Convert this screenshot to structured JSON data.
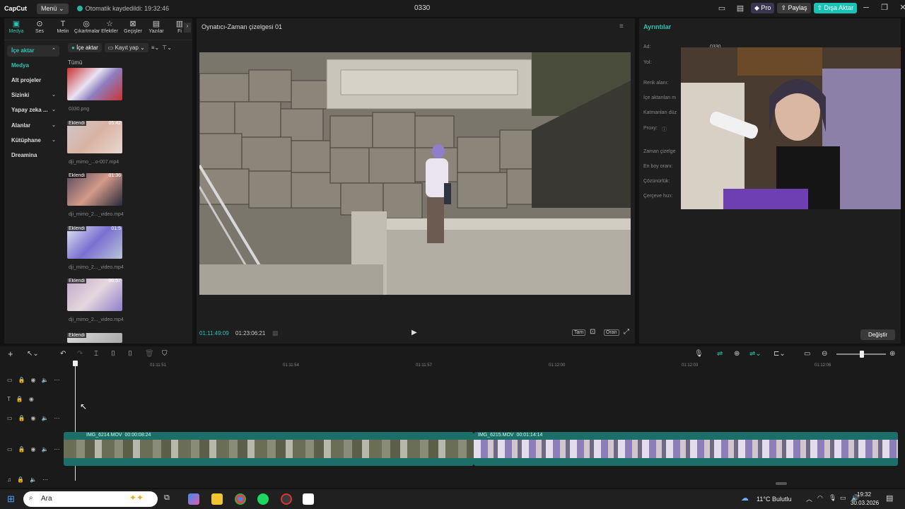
{
  "titlebar": {
    "logo": "CapCut",
    "menu": "Menü",
    "autosave": "Otomatik kaydedildi: 19:32:46",
    "title": "0330",
    "pro": "Pro",
    "share": "Paylaş",
    "export": "Dışa Aktar"
  },
  "tabs": [
    {
      "label": "Medya",
      "icon": "media-icon"
    },
    {
      "label": "Ses",
      "icon": "audio-icon"
    },
    {
      "label": "Metin",
      "icon": "text-icon"
    },
    {
      "label": "Çıkartmalar",
      "icon": "sticker-icon"
    },
    {
      "label": "Efektler",
      "icon": "effects-icon"
    },
    {
      "label": "Geçişler",
      "icon": "transitions-icon"
    },
    {
      "label": "Yazılar",
      "icon": "captions-icon"
    },
    {
      "label": "Fi",
      "icon": "filter-icon"
    }
  ],
  "sidebar": {
    "items": [
      {
        "label": "İçe aktar"
      },
      {
        "label": "Medya"
      },
      {
        "label": "Alt projeler"
      },
      {
        "label": "Sizinki"
      },
      {
        "label": "Yapay zeka ..."
      },
      {
        "label": "Alanlar"
      },
      {
        "label": "Kütüphane"
      },
      {
        "label": "Dreamina"
      }
    ]
  },
  "media_toolbar": {
    "import": "İçe aktar",
    "record": "Kayıt yap"
  },
  "media": {
    "group": "Tümü",
    "items": [
      {
        "name": "0330.png",
        "badge": "",
        "duration": ""
      },
      {
        "name": "dji_mimo_...o-007.mp4",
        "badge": "Eklendi",
        "duration": "05:42"
      },
      {
        "name": "dji_mimo_2..._video.mp4",
        "badge": "Eklendi",
        "duration": "01:36"
      },
      {
        "name": "dji_mimo_2..._video.mp4",
        "badge": "Eklendi",
        "duration": "01:5"
      },
      {
        "name": "dji_mimo_2..._video.mp4",
        "badge": "Eklendi",
        "duration": "00:57"
      },
      {
        "name": "",
        "badge": "Eklendi",
        "duration": ""
      }
    ]
  },
  "player": {
    "title": "Oynatıcı-Zaman çizelgesi 01",
    "current_time": "01:11:49:09",
    "total_time": "01:23:06:21",
    "full_label": "Tam",
    "ratio_label": "Oran"
  },
  "details": {
    "title": "Ayrıntılar",
    "labels": [
      "Ad:",
      "Yol:",
      "Renk alanı:",
      "İçe aktarılan m",
      "Katmanları düz",
      "Proxy:",
      "Zaman çizelge",
      "En boy oranı:",
      "Çözünürlük:",
      "Çerçeve hızı:"
    ],
    "name_value": "0330",
    "change_button": "Değiştir"
  },
  "timeline": {
    "ruler": [
      "01:11:51",
      "01:11:54",
      "01:11:57",
      "01:12:00",
      "01:12:03",
      "01:12:06"
    ],
    "clips": [
      {
        "name": "IMG_6214.MOV",
        "duration": "00:00:08:24"
      },
      {
        "name": "IMG_6215.MOV",
        "duration": "00:01:14:14"
      }
    ]
  },
  "taskbar": {
    "search": "Ara",
    "weather": "11°C  Bulutlu",
    "time": "19:32",
    "date": "30.03.2026"
  },
  "colors": {
    "accent": "#2bc5b4",
    "export": "#19c3b6",
    "clip": "#1c6e68"
  }
}
